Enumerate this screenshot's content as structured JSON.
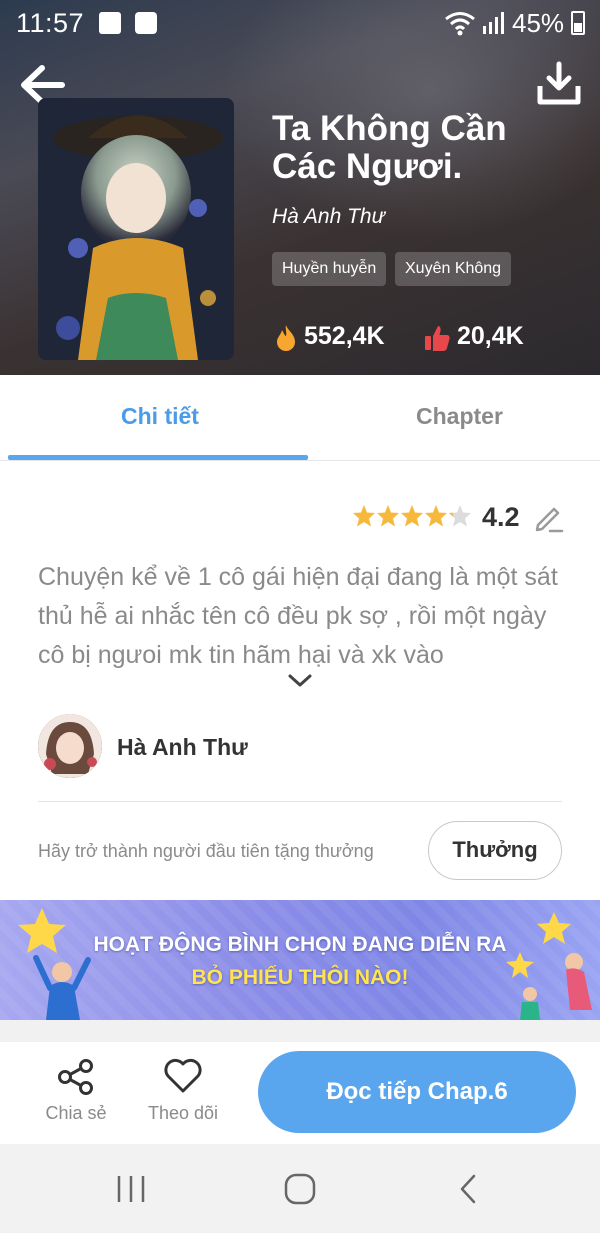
{
  "status_bar": {
    "time": "11:57",
    "battery": "45%"
  },
  "book": {
    "title": "Ta Không Cần Các Ngươi.",
    "author": "Hà Anh Thư",
    "tags": [
      "Huyền huyễn",
      "Xuyên Không"
    ],
    "views": "552,4K",
    "likes": "20,4K"
  },
  "tabs": {
    "detail": "Chi tiết",
    "chapter": "Chapter",
    "active": "detail"
  },
  "rating": {
    "score": "4.2",
    "value": 4.2,
    "max": 5
  },
  "synopsis": "Chuyện kể về 1 cô gái hiện đại đang là một sát thủ hễ ai nhắc tên cô đều pk sợ , rồi một ngày cô bị ngưoi mk tin hãm hại và xk vào",
  "author_row": {
    "name": "Hà Anh Thư"
  },
  "gift": {
    "text": "Hãy trở thành người đầu tiên tặng thưởng",
    "button": "Thưởng"
  },
  "banner": {
    "line1": "HOẠT ĐỘNG BÌNH CHỌN ĐANG DIỄN RA",
    "line2": "BỎ PHIẾU THÔI NÀO!"
  },
  "actions": {
    "share": "Chia sẻ",
    "follow": "Theo dõi",
    "read": "Đọc tiếp Chap.6"
  },
  "icons": {
    "back": "arrow-left-icon",
    "download": "download-icon",
    "views": "fire-icon",
    "likes": "thumbs-up-icon",
    "edit": "pencil-icon",
    "expand": "chevron-down-icon",
    "share": "share-icon",
    "follow": "heart-icon"
  },
  "colors": {
    "accent": "#5aa6ee",
    "tab_active": "#4a9be8",
    "star": "#f6b93b",
    "views_icon": "#f7a630",
    "likes_icon": "#e8474b",
    "banner_yellow": "#ffe44d"
  }
}
